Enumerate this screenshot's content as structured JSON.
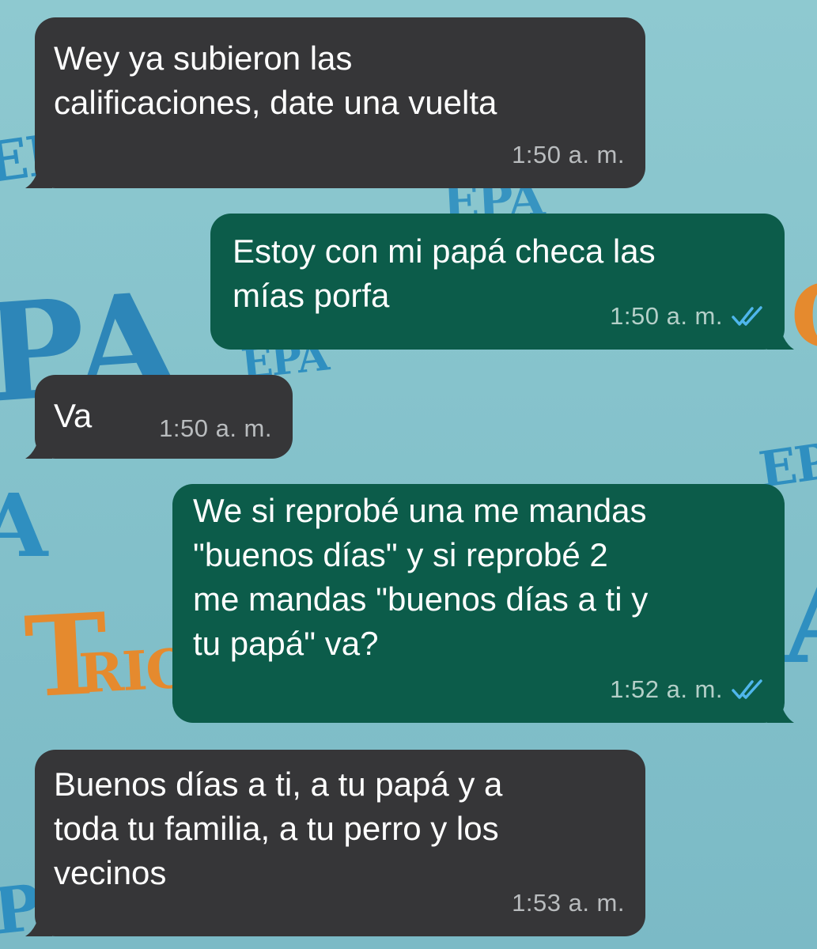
{
  "wallpaper": {
    "texts": [
      "EP",
      "EPA",
      "PA",
      "EPA",
      "G",
      "EP",
      "A",
      "T",
      "RIO",
      "A",
      "P"
    ],
    "colors": {
      "blue": "#2f8fc0",
      "orange": "#e58a2e"
    }
  },
  "messages": [
    {
      "direction": "incoming",
      "text": "Wey ya subieron las\ncalificaciones, date una vuelta",
      "time": "1:50 a. m."
    },
    {
      "direction": "outgoing",
      "text": "Estoy con mi papá checa las\nmías porfa",
      "time": "1:50 a. m.",
      "status_icon": "double-check-read-icon"
    },
    {
      "direction": "incoming",
      "text": "Va",
      "time": "1:50 a. m."
    },
    {
      "direction": "outgoing",
      "text": "We si reprobé una me mandas\n\"buenos días\" y si reprobé 2\nme mandas \"buenos días a ti y\ntu papá\" va?",
      "time": "1:52 a. m.",
      "status_icon": "double-check-read-icon"
    },
    {
      "direction": "incoming",
      "text": "Buenos días a ti, a tu papá y a\ntoda tu familia, a tu perro y los\nvecinos",
      "time": "1:53 a. m."
    }
  ],
  "colors": {
    "incoming_bubble": "#363638",
    "outgoing_bubble": "#0c5c4a",
    "read_tick": "#4fb6ec"
  }
}
